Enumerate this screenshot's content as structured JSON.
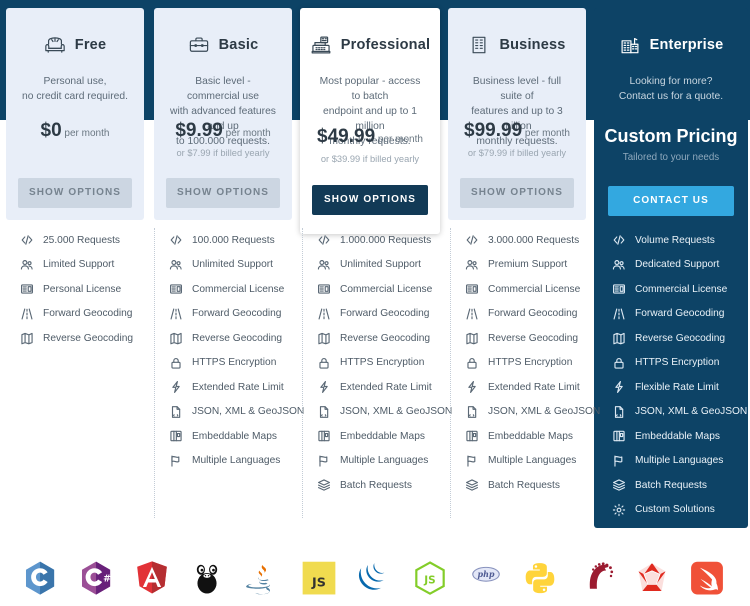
{
  "colors": {
    "navy_band": "#0d4366",
    "card_standard_bg": "#e8eef8",
    "card_pro_bg": "#ffffff",
    "card_enterprise_bg": "#0d4366",
    "cta_grey": "#ccd6e2",
    "cta_dark": "#123a56",
    "cta_blue": "#33a8e0",
    "text_dark": "#2d3a45",
    "text_muted": "#9aa6b1"
  },
  "plans": [
    {
      "id": "free",
      "icon": "armchair-icon",
      "title": "Free",
      "description": "Personal use,\nno credit card required.",
      "price": "$0",
      "price_period": "per month",
      "price_note": "",
      "cta_label": "SHOW OPTIONS",
      "cta_style": "grey",
      "features": [
        {
          "icon": "code-icon",
          "label": "25.000 Requests"
        },
        {
          "icon": "users-icon",
          "label": "Limited Support"
        },
        {
          "icon": "license-icon",
          "label": "Personal License"
        },
        {
          "icon": "road-icon",
          "label": "Forward Geocoding"
        },
        {
          "icon": "map-icon",
          "label": "Reverse Geocoding"
        }
      ]
    },
    {
      "id": "basic",
      "icon": "briefcase-icon",
      "title": "Basic",
      "description": "Basic level - commercial use\nwith advanced features and up\nto 100.000 requests.",
      "price": "$9.99",
      "price_period": "per month",
      "price_note": "or $7.99 if billed yearly",
      "cta_label": "SHOW OPTIONS",
      "cta_style": "grey",
      "features": [
        {
          "icon": "code-icon",
          "label": "100.000 Requests"
        },
        {
          "icon": "users-icon",
          "label": "Unlimited Support"
        },
        {
          "icon": "license-icon",
          "label": "Commercial License"
        },
        {
          "icon": "road-icon",
          "label": "Forward Geocoding"
        },
        {
          "icon": "map-icon",
          "label": "Reverse Geocoding"
        },
        {
          "icon": "lock-icon",
          "label": "HTTPS Encryption"
        },
        {
          "icon": "bolt-icon",
          "label": "Extended Rate Limit"
        },
        {
          "icon": "file-code-icon",
          "label": "JSON, XML & GeoJSON"
        },
        {
          "icon": "embed-map-icon",
          "label": "Embeddable Maps"
        },
        {
          "icon": "flag-icon",
          "label": "Multiple Languages"
        }
      ]
    },
    {
      "id": "professional",
      "icon": "cash-register-icon",
      "title": "Professional",
      "description": "Most popular - access to batch\nendpoint and up to 1 million\nmonthly requests.",
      "price": "$49.99",
      "price_period": "per month",
      "price_note": "or $39.99 if billed yearly",
      "cta_label": "SHOW OPTIONS",
      "cta_style": "dark",
      "features": [
        {
          "icon": "code-icon",
          "label": "1.000.000 Requests"
        },
        {
          "icon": "users-icon",
          "label": "Unlimited Support"
        },
        {
          "icon": "license-icon",
          "label": "Commercial License"
        },
        {
          "icon": "road-icon",
          "label": "Forward Geocoding"
        },
        {
          "icon": "map-icon",
          "label": "Reverse Geocoding"
        },
        {
          "icon": "lock-icon",
          "label": "HTTPS Encryption"
        },
        {
          "icon": "bolt-icon",
          "label": "Extended Rate Limit"
        },
        {
          "icon": "file-code-icon",
          "label": "JSON, XML & GeoJSON"
        },
        {
          "icon": "embed-map-icon",
          "label": "Embeddable Maps"
        },
        {
          "icon": "flag-icon",
          "label": "Multiple Languages"
        },
        {
          "icon": "layers-icon",
          "label": "Batch Requests"
        }
      ]
    },
    {
      "id": "business",
      "icon": "building-icon",
      "title": "Business",
      "description": "Business level - full suite of\nfeatures and up to 3 million\nmonthly requests.",
      "price": "$99.99",
      "price_period": "per month",
      "price_note": "or $79.99 if billed yearly",
      "cta_label": "SHOW OPTIONS",
      "cta_style": "grey",
      "features": [
        {
          "icon": "code-icon",
          "label": "3.000.000 Requests"
        },
        {
          "icon": "users-icon",
          "label": "Premium Support"
        },
        {
          "icon": "license-icon",
          "label": "Commercial License"
        },
        {
          "icon": "road-icon",
          "label": "Forward Geocoding"
        },
        {
          "icon": "map-icon",
          "label": "Reverse Geocoding"
        },
        {
          "icon": "lock-icon",
          "label": "HTTPS Encryption"
        },
        {
          "icon": "bolt-icon",
          "label": "Extended Rate Limit"
        },
        {
          "icon": "file-code-icon",
          "label": "JSON, XML & GeoJSON"
        },
        {
          "icon": "embed-map-icon",
          "label": "Embeddable Maps"
        },
        {
          "icon": "flag-icon",
          "label": "Multiple Languages"
        },
        {
          "icon": "layers-icon",
          "label": "Batch Requests"
        }
      ]
    },
    {
      "id": "enterprise",
      "icon": "city-icon",
      "title": "Enterprise",
      "description": "Looking for more?\nContact us for a quote.",
      "price": "Custom Pricing",
      "price_period": "",
      "price_note": "Tailored to your needs",
      "cta_label": "CONTACT US",
      "cta_style": "blue",
      "features": [
        {
          "icon": "code-icon",
          "label": "Volume Requests"
        },
        {
          "icon": "users-icon",
          "label": "Dedicated Support"
        },
        {
          "icon": "license-icon",
          "label": "Commercial License"
        },
        {
          "icon": "road-icon",
          "label": "Forward Geocoding"
        },
        {
          "icon": "map-icon",
          "label": "Reverse Geocoding"
        },
        {
          "icon": "lock-icon",
          "label": "HTTPS Encryption"
        },
        {
          "icon": "bolt-icon",
          "label": "Flexible Rate Limit"
        },
        {
          "icon": "file-code-icon",
          "label": "JSON, XML & GeoJSON"
        },
        {
          "icon": "embed-map-icon",
          "label": "Embeddable Maps"
        },
        {
          "icon": "flag-icon",
          "label": "Multiple Languages"
        },
        {
          "icon": "layers-icon",
          "label": "Batch Requests"
        },
        {
          "icon": "gear-icon",
          "label": "Custom Solutions"
        }
      ]
    }
  ],
  "logos": [
    {
      "id": "c-logo",
      "label": "C"
    },
    {
      "id": "csharp-logo",
      "label": "C#"
    },
    {
      "id": "angular-logo",
      "label": "Angular"
    },
    {
      "id": "go-logo",
      "label": "Go"
    },
    {
      "id": "java-logo",
      "label": "Java"
    },
    {
      "id": "javascript-logo",
      "label": "JS"
    },
    {
      "id": "jquery-logo",
      "label": "jQuery"
    },
    {
      "id": "nodejs-logo",
      "label": "Node.js"
    },
    {
      "id": "php-logo",
      "label": "php"
    },
    {
      "id": "python-logo",
      "label": "Python"
    },
    {
      "id": "rails-logo",
      "label": "Rails"
    },
    {
      "id": "ruby-logo",
      "label": "Ruby"
    },
    {
      "id": "swift-logo",
      "label": "Swift"
    }
  ]
}
